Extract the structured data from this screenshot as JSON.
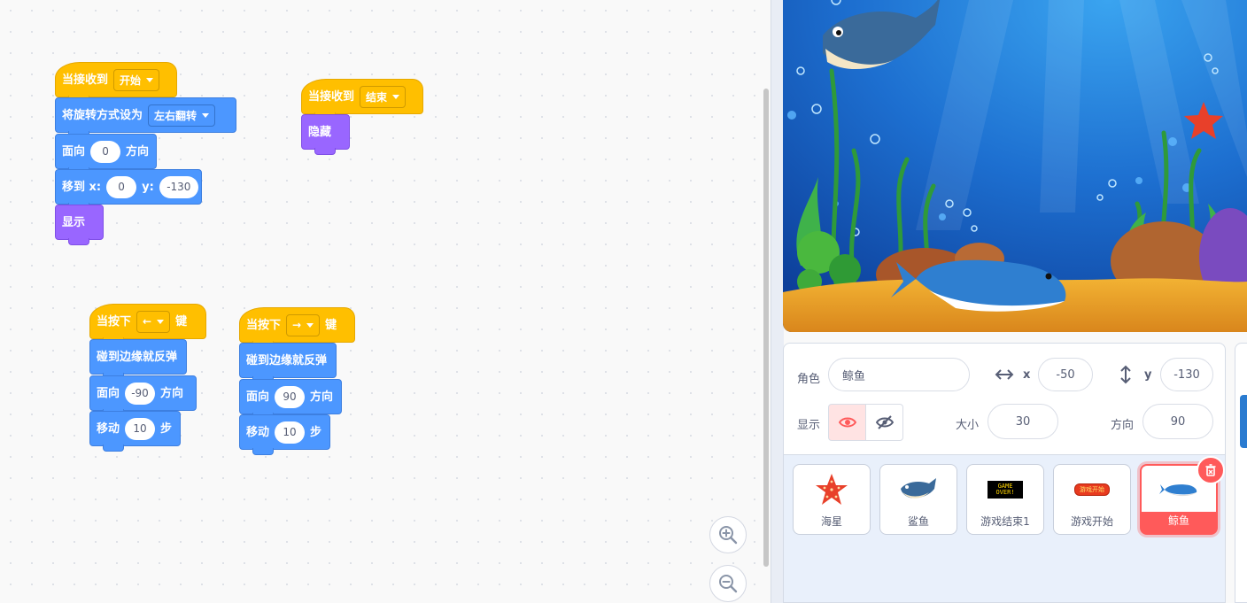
{
  "scripts": {
    "s1": {
      "hat": "当接收到",
      "hat_value": "开始",
      "rotate_label": "将旋转方式设为",
      "rotate_value": "左右翻转",
      "face_label": "面向",
      "face_value": "0",
      "face_suffix": "方向",
      "goto_label": "移到 x:",
      "goto_x": "0",
      "goto_y_label": "y:",
      "goto_y": "-130",
      "show": "显示"
    },
    "s2": {
      "hat": "当接收到",
      "hat_value": "结束",
      "hide": "隐藏"
    },
    "s3": {
      "hat": "当按下",
      "key": "←",
      "key_suffix": "键",
      "bounce": "碰到边缘就反弹",
      "face_label": "面向",
      "face_value": "-90",
      "face_suffix": "方向",
      "move_label": "移动",
      "move_value": "10",
      "move_suffix": "步"
    },
    "s4": {
      "hat": "当按下",
      "key": "→",
      "key_suffix": "键",
      "bounce": "碰到边缘就反弹",
      "face_label": "面向",
      "face_value": "90",
      "face_suffix": "方向",
      "move_label": "移动",
      "move_value": "10",
      "move_suffix": "步"
    }
  },
  "zoom": {
    "in_icon": "zoom-in-icon",
    "out_icon": "zoom-out-icon"
  },
  "sprite_info": {
    "sprite_label": "角色",
    "sprite_name": "鲸鱼",
    "x_label": "x",
    "x_value": "-50",
    "y_label": "y",
    "y_value": "-130",
    "show_label": "显示",
    "size_label": "大小",
    "size_value": "30",
    "direction_label": "方向",
    "direction_value": "90"
  },
  "sprites": [
    {
      "name": "海星",
      "icon": "starfish-icon"
    },
    {
      "name": "鲨鱼",
      "icon": "shark-icon"
    },
    {
      "name": "游戏结束1",
      "icon": "game-over-icon",
      "thumb_text": "GAME OVER!"
    },
    {
      "name": "游戏开始",
      "icon": "game-start-icon",
      "thumb_text": "游戏开始"
    },
    {
      "name": "鲸鱼",
      "icon": "whale-icon",
      "selected": true
    }
  ],
  "colors": {
    "events": "#ffbf00",
    "motion": "#4c97ff",
    "looks": "#9966ff",
    "selected": "#ff5a5a"
  }
}
